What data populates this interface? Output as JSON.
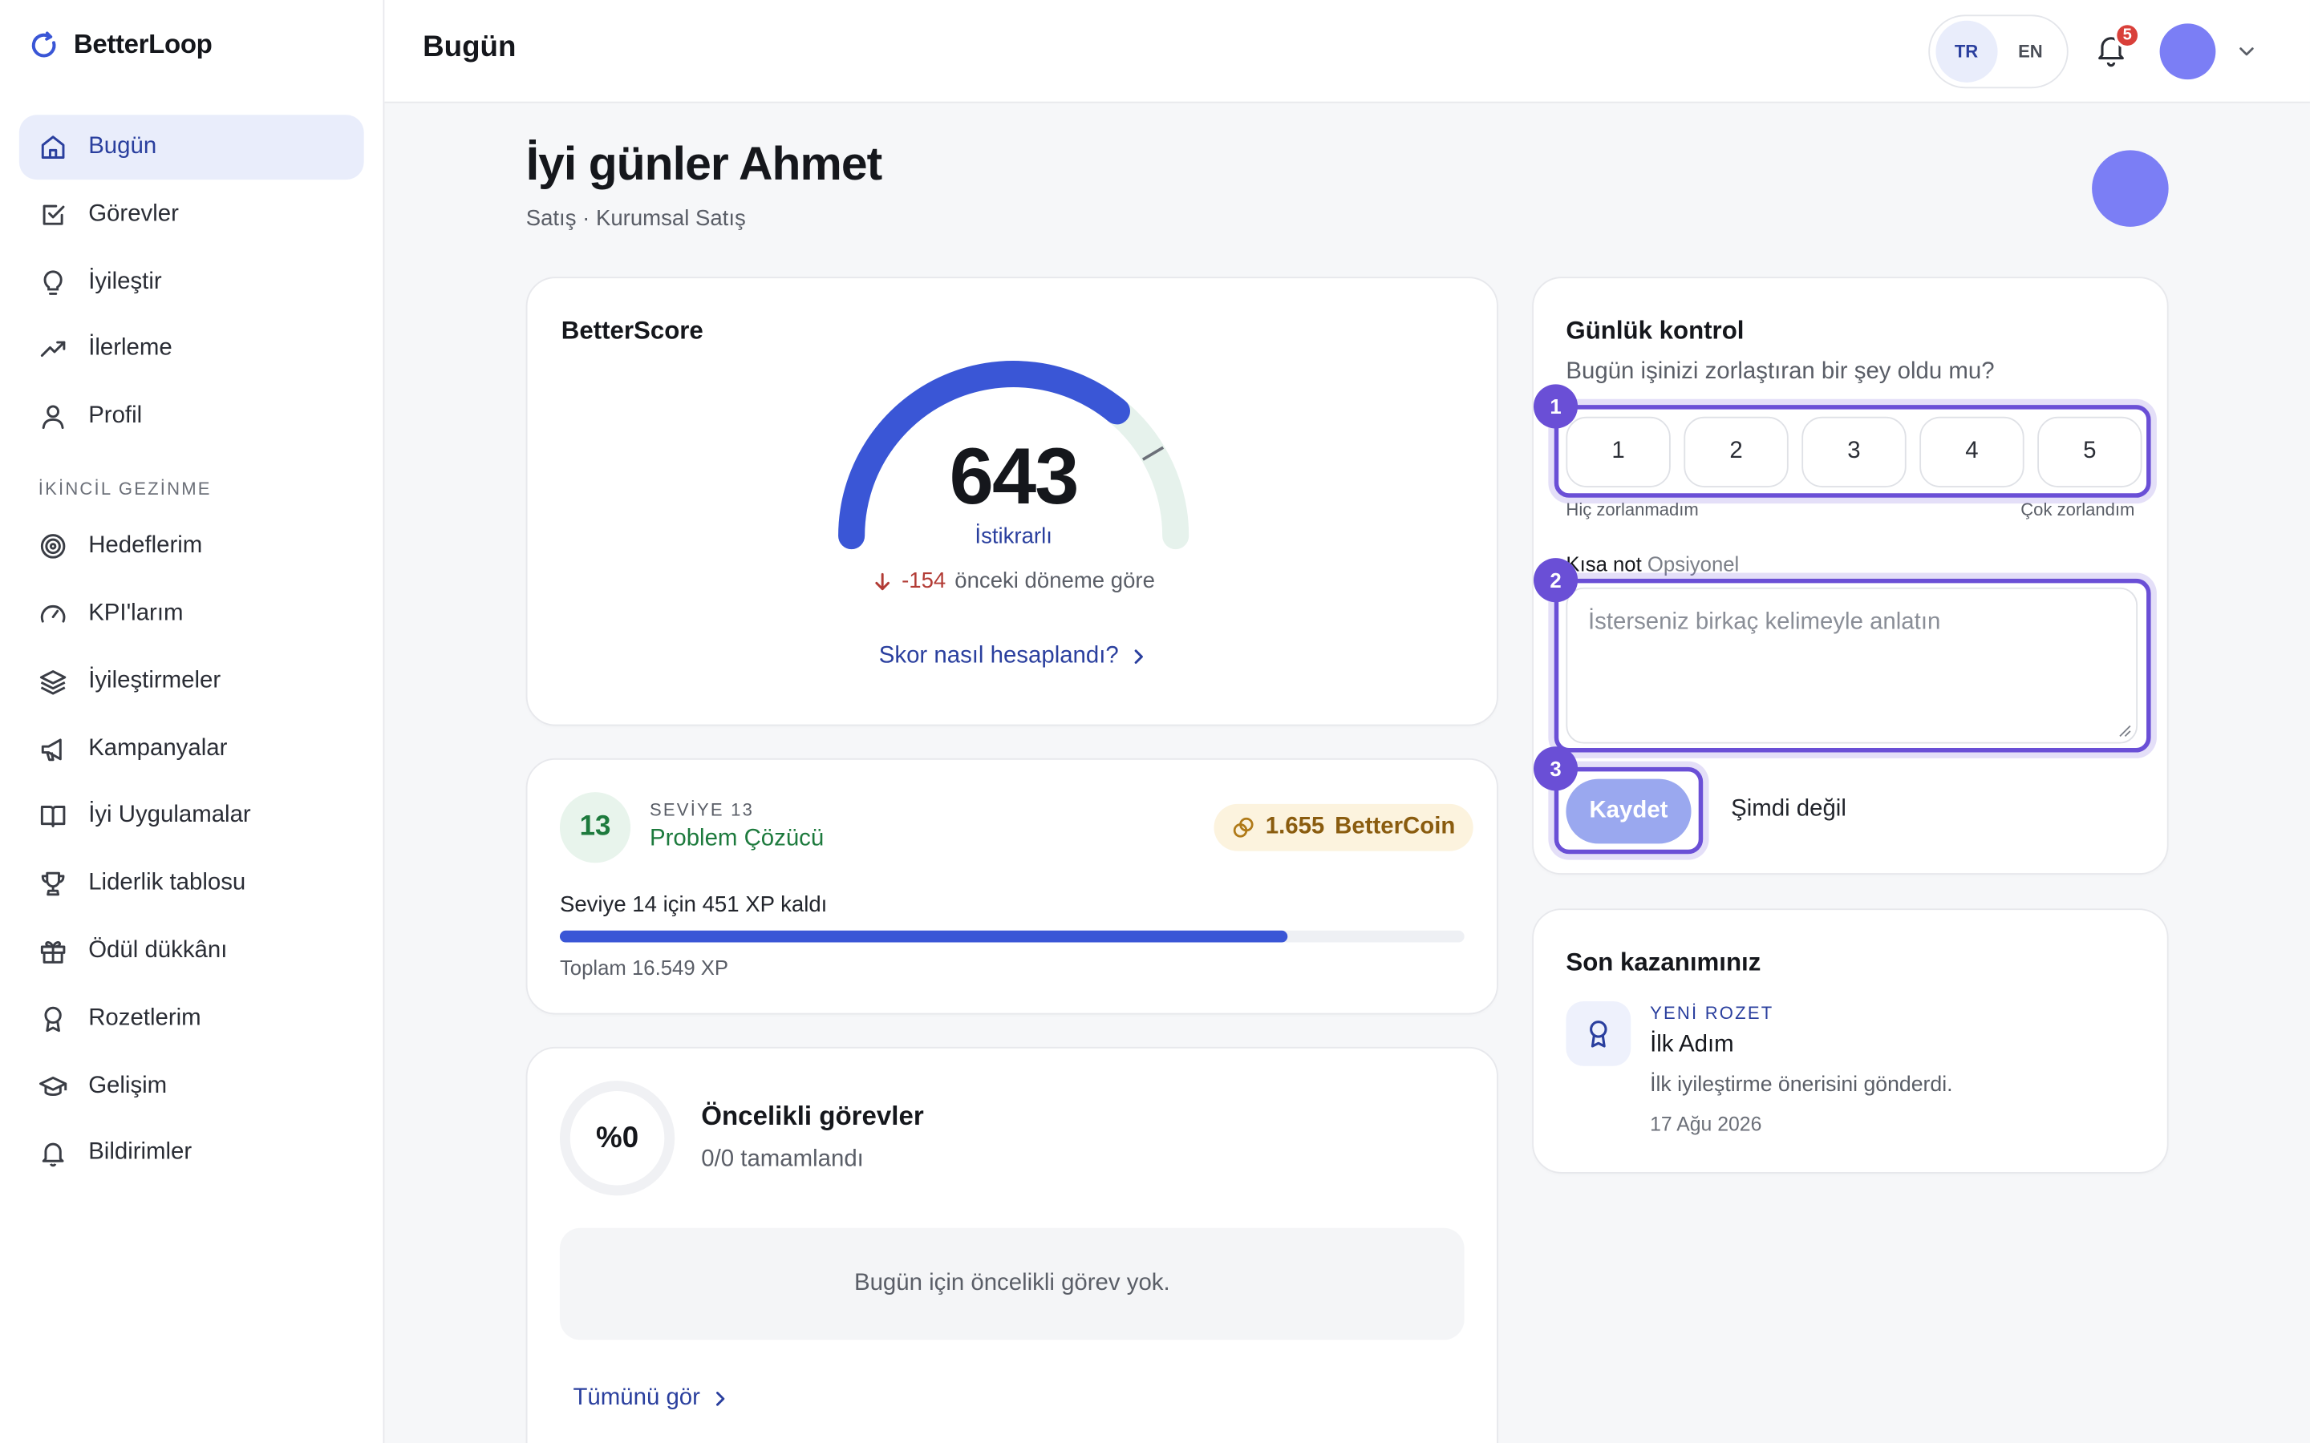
{
  "app": {
    "name": "BetterLoop",
    "page_title": "Bugün"
  },
  "sidebar": {
    "items": [
      {
        "label": "Bugün",
        "icon": "home-icon",
        "active": true
      },
      {
        "label": "Görevler",
        "icon": "checkbox-icon"
      },
      {
        "label": "İyileştir",
        "icon": "lightbulb-icon"
      },
      {
        "label": "İlerleme",
        "icon": "trending-up-icon"
      },
      {
        "label": "Profil",
        "icon": "user-icon"
      }
    ],
    "section_label": "İKİNCİL GEZİNME",
    "secondary_items": [
      {
        "label": "Hedeflerim",
        "icon": "target-icon"
      },
      {
        "label": "KPI'larım",
        "icon": "gauge-icon"
      },
      {
        "label": "İyileştirmeler",
        "icon": "layers-icon"
      },
      {
        "label": "Kampanyalar",
        "icon": "megaphone-icon"
      },
      {
        "label": "İyi Uygulamalar",
        "icon": "book-icon"
      },
      {
        "label": "Liderlik tablosu",
        "icon": "trophy-icon"
      },
      {
        "label": "Ödül dükkânı",
        "icon": "gift-icon"
      },
      {
        "label": "Rozetlerim",
        "icon": "badge-icon"
      },
      {
        "label": "Gelişim",
        "icon": "graduation-cap-icon"
      },
      {
        "label": "Bildirimler",
        "icon": "bell-icon"
      }
    ]
  },
  "topbar": {
    "lang_tr": "TR",
    "lang_en": "EN",
    "notification_count": "5"
  },
  "header": {
    "greeting": "İyi günler Ahmet",
    "subtitle": "Satış · Kurumsal Satış"
  },
  "score": {
    "title": "BetterScore",
    "value": "643",
    "value_fraction": 0.72,
    "status": "İstikrarlı",
    "delta": "-154",
    "delta_suffix": "önceki döneme göre",
    "link": "Skor nasıl hesaplandı?",
    "colors": {
      "arc": "#3a56d6",
      "track": "#e6f2ec"
    }
  },
  "level": {
    "number": "13",
    "kicker": "SEVİYE 13",
    "name": "Problem Çözücü",
    "coins": "1.655",
    "coin_label": "BetterCoin",
    "xp_left": "Seviye 14 için 451 XP kaldı",
    "progress": 0.805,
    "total": "Toplam 16.549 XP"
  },
  "tasks": {
    "percent": "%0",
    "title": "Öncelikli görevler",
    "sub": "0/0 tamamlandı",
    "empty": "Bugün için öncelikli görev yok.",
    "see_all": "Tümünü gör"
  },
  "daily": {
    "title": "Günlük kontrol",
    "question": "Bugün işinizi zorlaştıran bir şey oldu mu?",
    "ratings": [
      "1",
      "2",
      "3",
      "4",
      "5"
    ],
    "scale_low": "Hiç zorlanmadım",
    "scale_high": "Çok zorlandım",
    "note_label": "Kısa not",
    "note_optional": "Opsiyonel",
    "note_placeholder": "İsterseniz birkaç kelimeyle anlatın",
    "save": "Kaydet",
    "later": "Şimdi değil",
    "markers": [
      "1",
      "2",
      "3"
    ]
  },
  "recent": {
    "title": "Son kazanımınız",
    "kicker": "YENİ ROZET",
    "name": "İlk Adım",
    "desc": "İlk iyileştirme önerisini gönderdi.",
    "date": "17 Ağu 2026"
  }
}
